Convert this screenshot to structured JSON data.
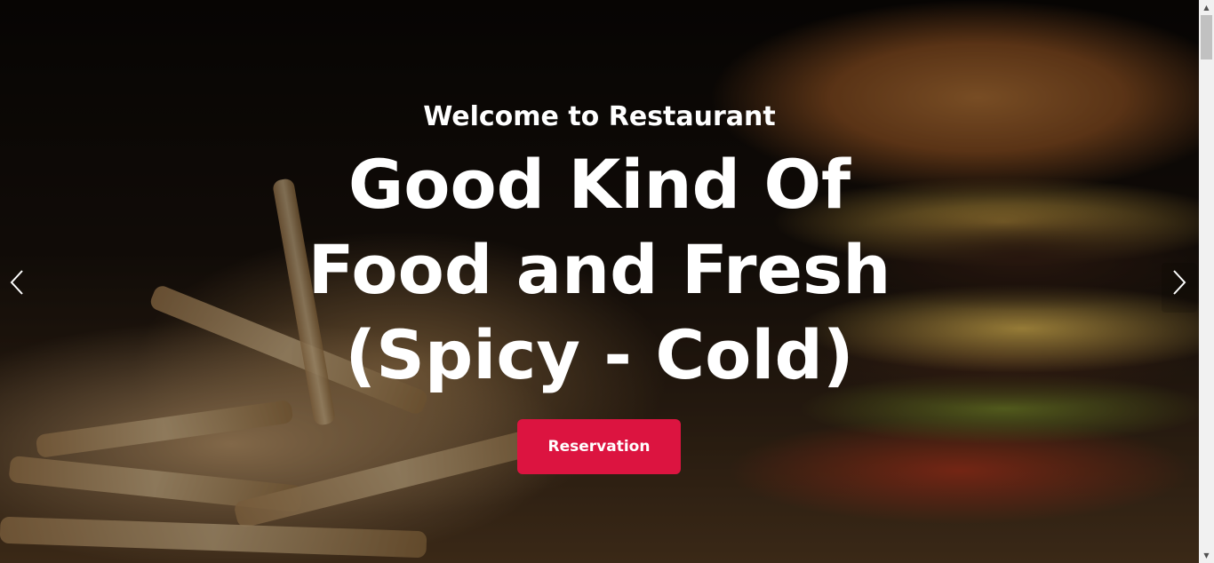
{
  "hero": {
    "subtitle": "Welcome to Restaurant",
    "headline_lines": [
      "Good Kind Of",
      "Food and Fresh",
      "(Spicy - Cold)"
    ],
    "reservation_button": "Reservation",
    "prev_icon": "chevron-left-icon",
    "next_icon": "chevron-right-icon"
  },
  "colors": {
    "accent": "#dc1440",
    "text": "#ffffff"
  }
}
